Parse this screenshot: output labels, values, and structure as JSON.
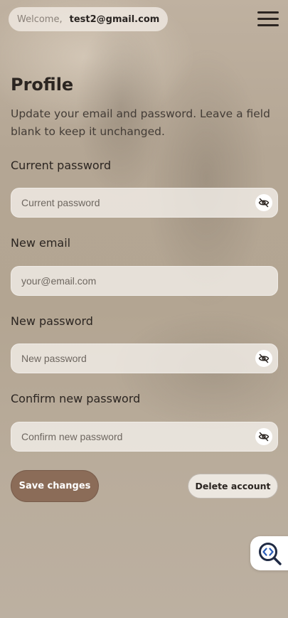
{
  "header": {
    "welcome_label": "Welcome,",
    "user_email": "test2@gmail.com",
    "menu_icon": "hamburger-menu-icon"
  },
  "profile": {
    "title": "Profile",
    "subtitle": "Update your email and password. Leave a field blank to keep it unchanged."
  },
  "fields": {
    "current_password": {
      "label": "Current password",
      "placeholder": "Current password",
      "value": "",
      "toggle_icon": "eye-off-icon"
    },
    "new_email": {
      "label": "New email",
      "placeholder": "your@email.com",
      "value": ""
    },
    "new_password": {
      "label": "New password",
      "placeholder": "New password",
      "value": "",
      "toggle_icon": "eye-off-icon"
    },
    "confirm_password": {
      "label": "Confirm new password",
      "placeholder": "Confirm new password",
      "value": "",
      "toggle_icon": "eye-off-icon"
    }
  },
  "actions": {
    "save_label": "Save changes",
    "delete_label": "Delete account"
  },
  "floating": {
    "inspector_icon": "code-search-icon"
  },
  "colors": {
    "primary_button": "#8b6c58",
    "text": "#2b2521",
    "field_background": "#f5f1ec",
    "inspector_icon": "#1f2a44"
  }
}
